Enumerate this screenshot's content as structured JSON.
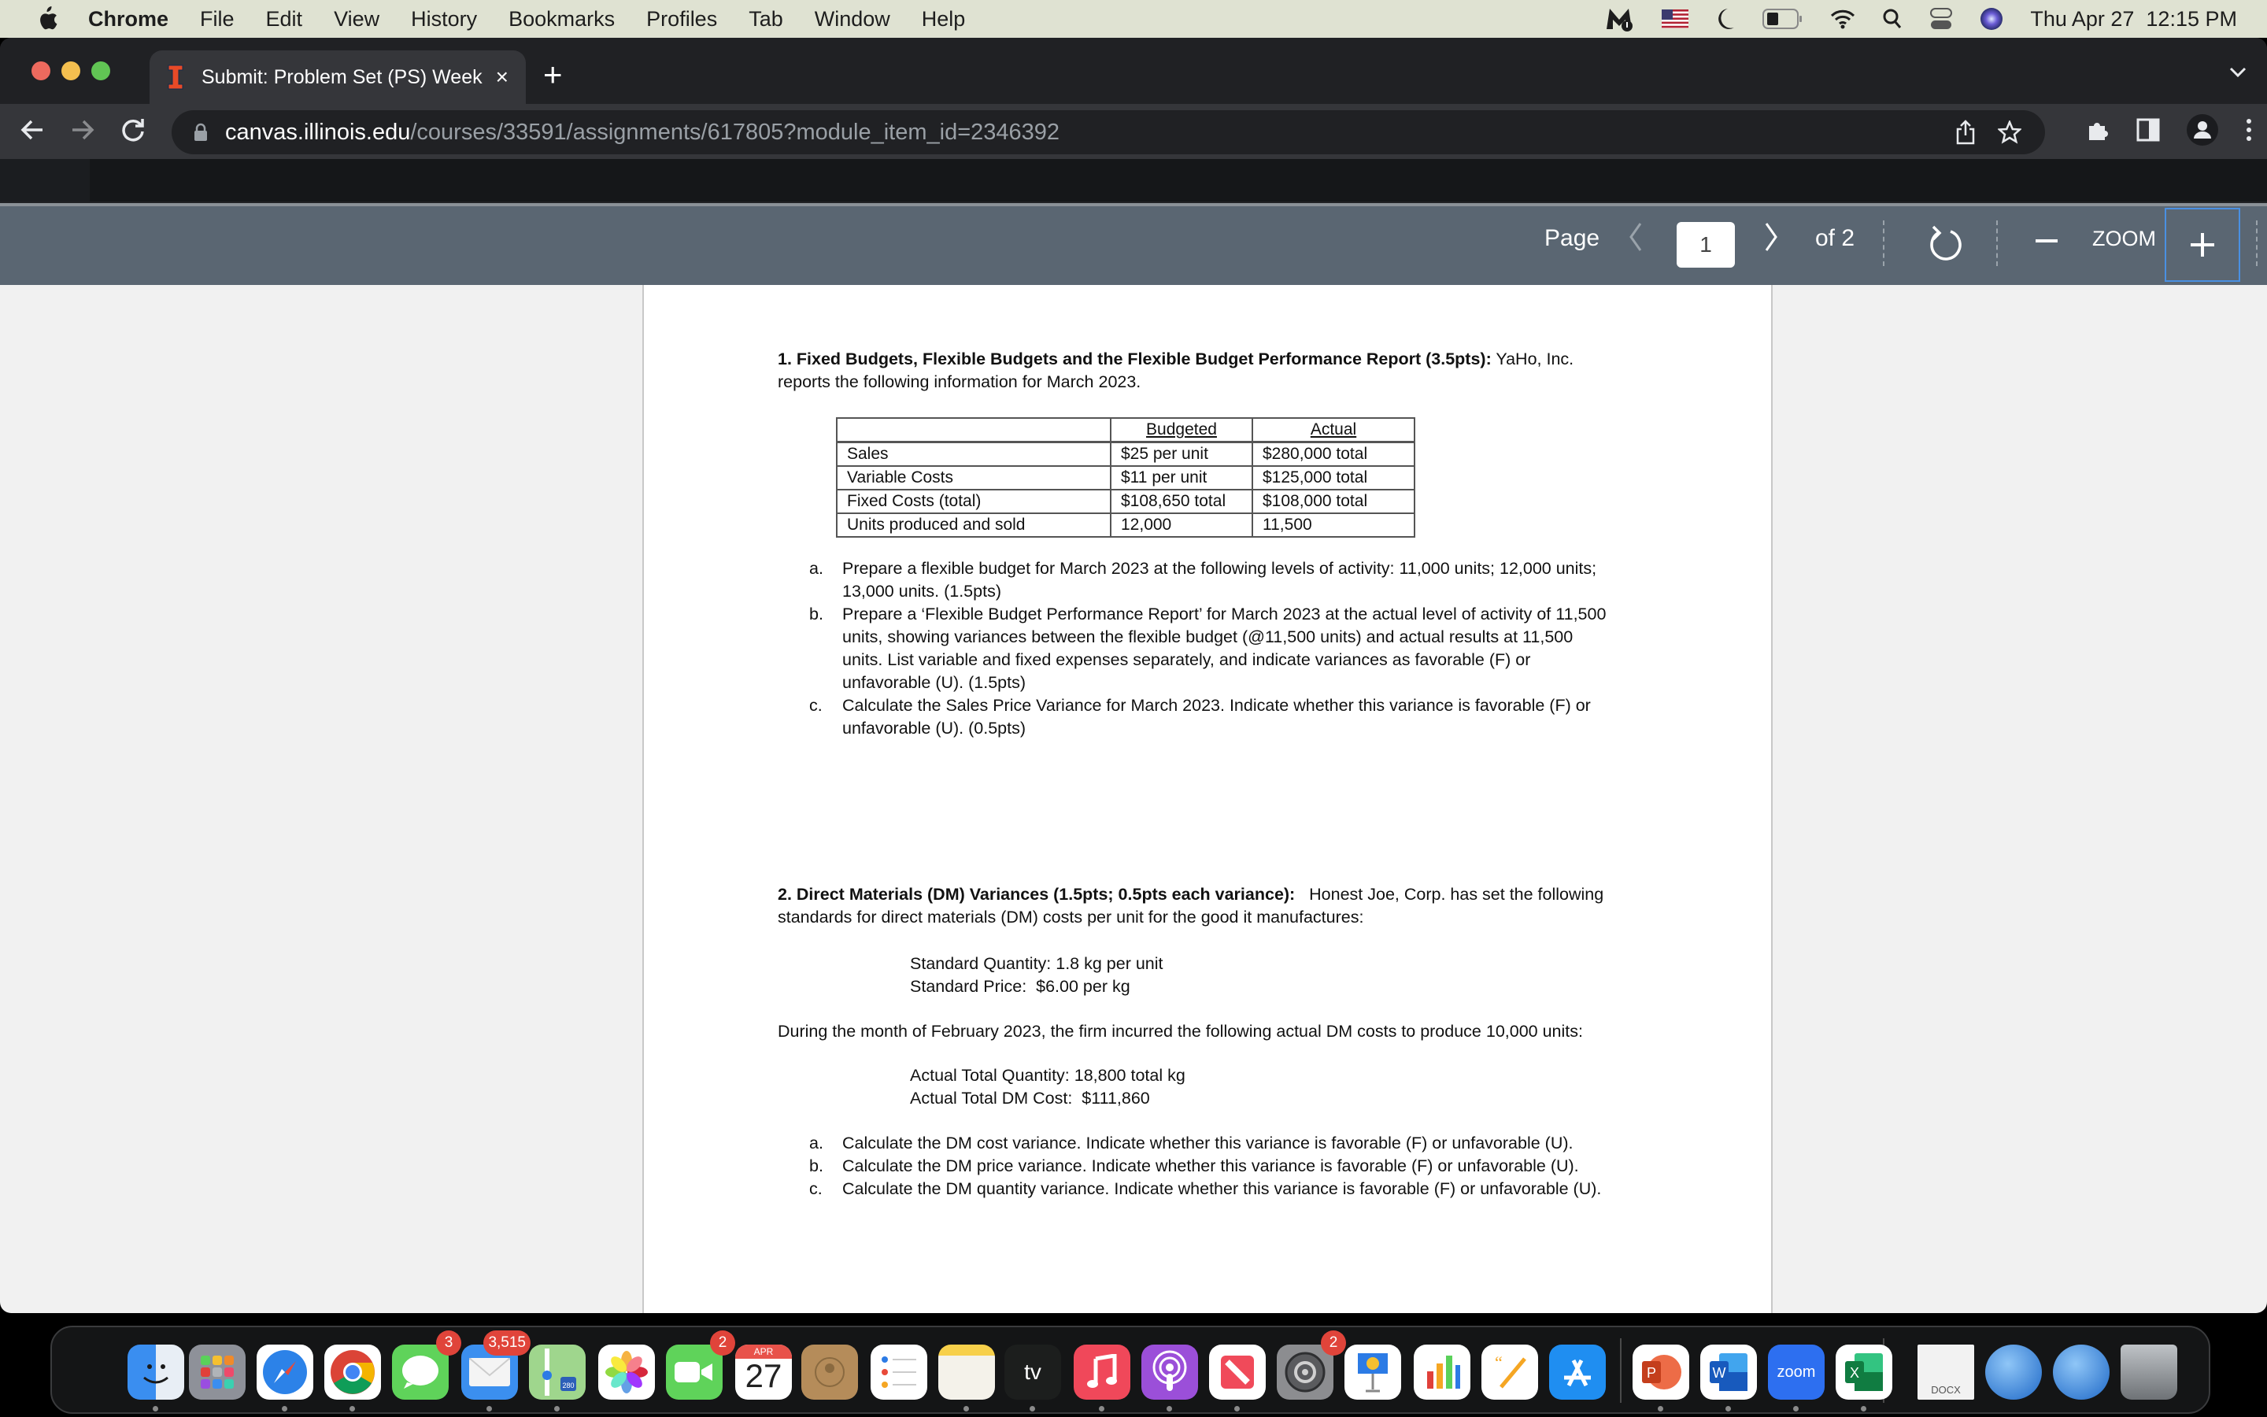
{
  "menubar": {
    "app_name": "Chrome",
    "items": [
      "File",
      "Edit",
      "View",
      "History",
      "Bookmarks",
      "Profiles",
      "Tab",
      "Window",
      "Help"
    ],
    "clock": "Thu Apr 27  12:15 PM",
    "status_icons": [
      "malwarebytes-icon",
      "us-flag-input-icon",
      "do-not-disturb-moon-icon",
      "battery-icon",
      "wifi-icon",
      "spotlight-search-icon",
      "control-center-icon",
      "siri-icon"
    ]
  },
  "browser": {
    "tab_title": "Submit: Problem Set (PS) Week",
    "tab_close": "×",
    "new_tab": "+",
    "url_host": "canvas.illinois.edu",
    "url_path": "/courses/33591/assignments/617805?module_item_id=2346392",
    "colors": {
      "close": "#ed6a5e",
      "minimize": "#f4bf4f",
      "maximize": "#61c554",
      "favicon": "#e84a27"
    }
  },
  "pdf_toolbar": {
    "page_label": "Page",
    "current_page": "1",
    "of_label": "of 2",
    "zoom_label": "ZOOM",
    "zoom_out": "—",
    "zoom_in": "+"
  },
  "document": {
    "q1": {
      "heading": "1. Fixed Budgets, Flexible Budgets and the Flexible Budget Performance Report (3.5pts):",
      "intro_rest": " YaHo, Inc. reports the following information for March 2023.",
      "table": {
        "headers": [
          "",
          "Budgeted",
          "Actual"
        ],
        "rows": [
          [
            "Sales",
            "$25 per unit",
            "$280,000 total"
          ],
          [
            "Variable Costs",
            "$11 per unit",
            "$125,000 total"
          ],
          [
            "Fixed Costs (total)",
            "$108,650 total",
            "$108,000 total"
          ],
          [
            "Units produced and sold",
            "12,000",
            "11,500"
          ]
        ]
      },
      "parts": [
        {
          "marker": "a.",
          "text": "Prepare a flexible budget for March 2023 at the following levels of activity:  11,000 units;  12,000 units; 13,000 units. (1.5pts)"
        },
        {
          "marker": "b.",
          "text": "Prepare a ‘Flexible Budget Performance Report’ for March 2023 at the actual level of activity of 11,500 units, showing variances between the flexible budget (@11,500 units) and actual results at 11,500 units. List variable and fixed expenses separately, and indicate variances as favorable (F) or unfavorable (U). (1.5pts)"
        },
        {
          "marker": "c.",
          "text": "Calculate the Sales Price Variance for March 2023.  Indicate whether this variance is favorable (F) or unfavorable (U). (0.5pts)"
        }
      ]
    },
    "q2": {
      "heading": "2. Direct Materials (DM) Variances (1.5pts; 0.5pts each variance):",
      "intro_rest": "   Honest Joe, Corp. has set the following standards for direct materials (DM) costs per unit for the good it manufactures:",
      "standards": [
        "Standard Quantity: 1.8 kg per unit",
        "Standard Price:  $6.00 per kg"
      ],
      "during": "During the month of February 2023, the firm incurred the following actual DM costs to produce 10,000 units:",
      "actuals": [
        "Actual Total Quantity: 18,800 total kg",
        "Actual Total DM Cost:  $111,860"
      ],
      "parts": [
        {
          "marker": "a.",
          "text": "Calculate the DM cost variance.  Indicate whether this variance is favorable (F) or unfavorable (U)."
        },
        {
          "marker": "b.",
          "text": "Calculate the DM price variance.  Indicate whether this variance is favorable (F) or unfavorable (U)."
        },
        {
          "marker": "c.",
          "text": "Calculate the DM quantity variance.  Indicate whether this variance is favorable (F) or unfavorable (U)."
        }
      ]
    }
  },
  "dock": {
    "apps": [
      {
        "name": "finder",
        "badge": null,
        "running": true
      },
      {
        "name": "launchpad",
        "badge": null,
        "running": false
      },
      {
        "name": "safari",
        "badge": null,
        "running": true
      },
      {
        "name": "chrome",
        "badge": null,
        "running": true
      },
      {
        "name": "messages",
        "badge": "3",
        "running": false
      },
      {
        "name": "mail",
        "badge": "3,515",
        "running": true
      },
      {
        "name": "maps",
        "badge": null,
        "running": true,
        "label": "280"
      },
      {
        "name": "photos",
        "badge": null,
        "running": false
      },
      {
        "name": "facetime",
        "badge": "2",
        "running": false
      },
      {
        "name": "calendar",
        "badge": null,
        "running": false,
        "month": "APR",
        "day": "27"
      },
      {
        "name": "contacts",
        "badge": null,
        "running": false
      },
      {
        "name": "reminders",
        "badge": null,
        "running": false
      },
      {
        "name": "notes",
        "badge": null,
        "running": true
      },
      {
        "name": "apple-tv",
        "badge": null,
        "running": true,
        "label": "tv"
      },
      {
        "name": "music",
        "badge": null,
        "running": true
      },
      {
        "name": "podcasts",
        "badge": null,
        "running": true
      },
      {
        "name": "news",
        "badge": null,
        "running": true
      },
      {
        "name": "system-preferences",
        "badge": "2",
        "running": false
      },
      {
        "name": "keynote",
        "badge": null,
        "running": false
      },
      {
        "name": "numbers",
        "badge": null,
        "running": false
      },
      {
        "name": "pages",
        "badge": null,
        "running": false
      },
      {
        "name": "app-store",
        "badge": null,
        "running": false
      },
      {
        "name": "powerpoint",
        "badge": null,
        "running": true,
        "label": "P"
      },
      {
        "name": "word",
        "badge": null,
        "running": true,
        "label": "W"
      },
      {
        "name": "zoom",
        "badge": null,
        "running": true,
        "label": "zoom"
      },
      {
        "name": "excel",
        "badge": null,
        "running": true,
        "label": "X"
      },
      {
        "name": "docx-file",
        "badge": null,
        "running": false,
        "label": "DOCX"
      },
      {
        "name": "web-globe-1",
        "badge": null,
        "running": false
      },
      {
        "name": "web-globe-2",
        "badge": null,
        "running": false
      },
      {
        "name": "trash",
        "badge": null,
        "running": false
      }
    ]
  }
}
